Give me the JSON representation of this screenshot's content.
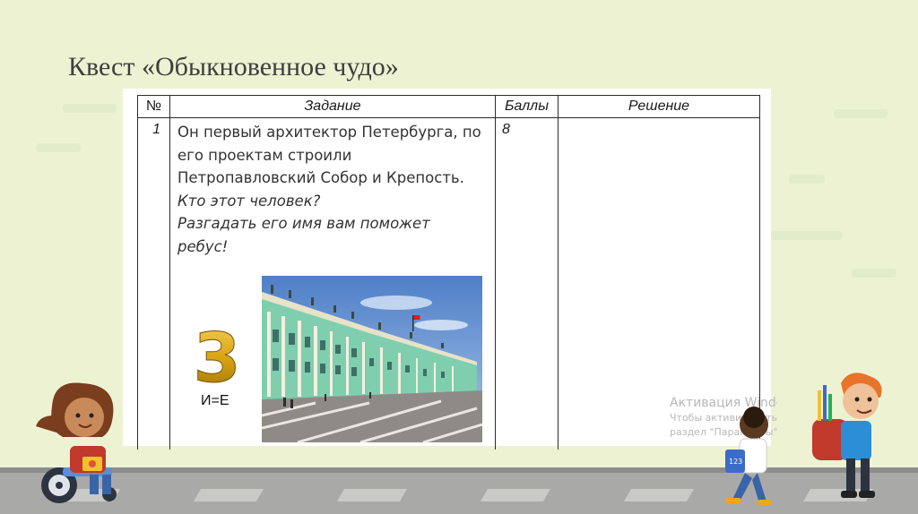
{
  "slide": {
    "title": "Квест «Обыкновенное чудо»"
  },
  "table": {
    "headers": {
      "num": "№",
      "task": "Задание",
      "points": "Баллы",
      "solution": "Решение"
    },
    "row": {
      "num": "1",
      "points": "8",
      "task_lines": [
        "Он первый архитектор Петербурга, по",
        "его проектам строили",
        "Петропавловский Собор и Крепость."
      ],
      "task_italic_lines": [
        "Кто этот человек?",
        "Разгадать его имя вам поможет",
        "ребус!"
      ],
      "rebus": {
        "digit": "3",
        "hint": "И=Е"
      },
      "solution": ""
    }
  },
  "watermark": {
    "title": "Активация Windows",
    "line1": "Чтобы активировать Windows, перейдите в",
    "line2": "раздел \"Параметры\"."
  },
  "colors": {
    "background": "#edf3d2",
    "digit_gold": "#d9a514",
    "palace_green": "#7fcfae"
  }
}
